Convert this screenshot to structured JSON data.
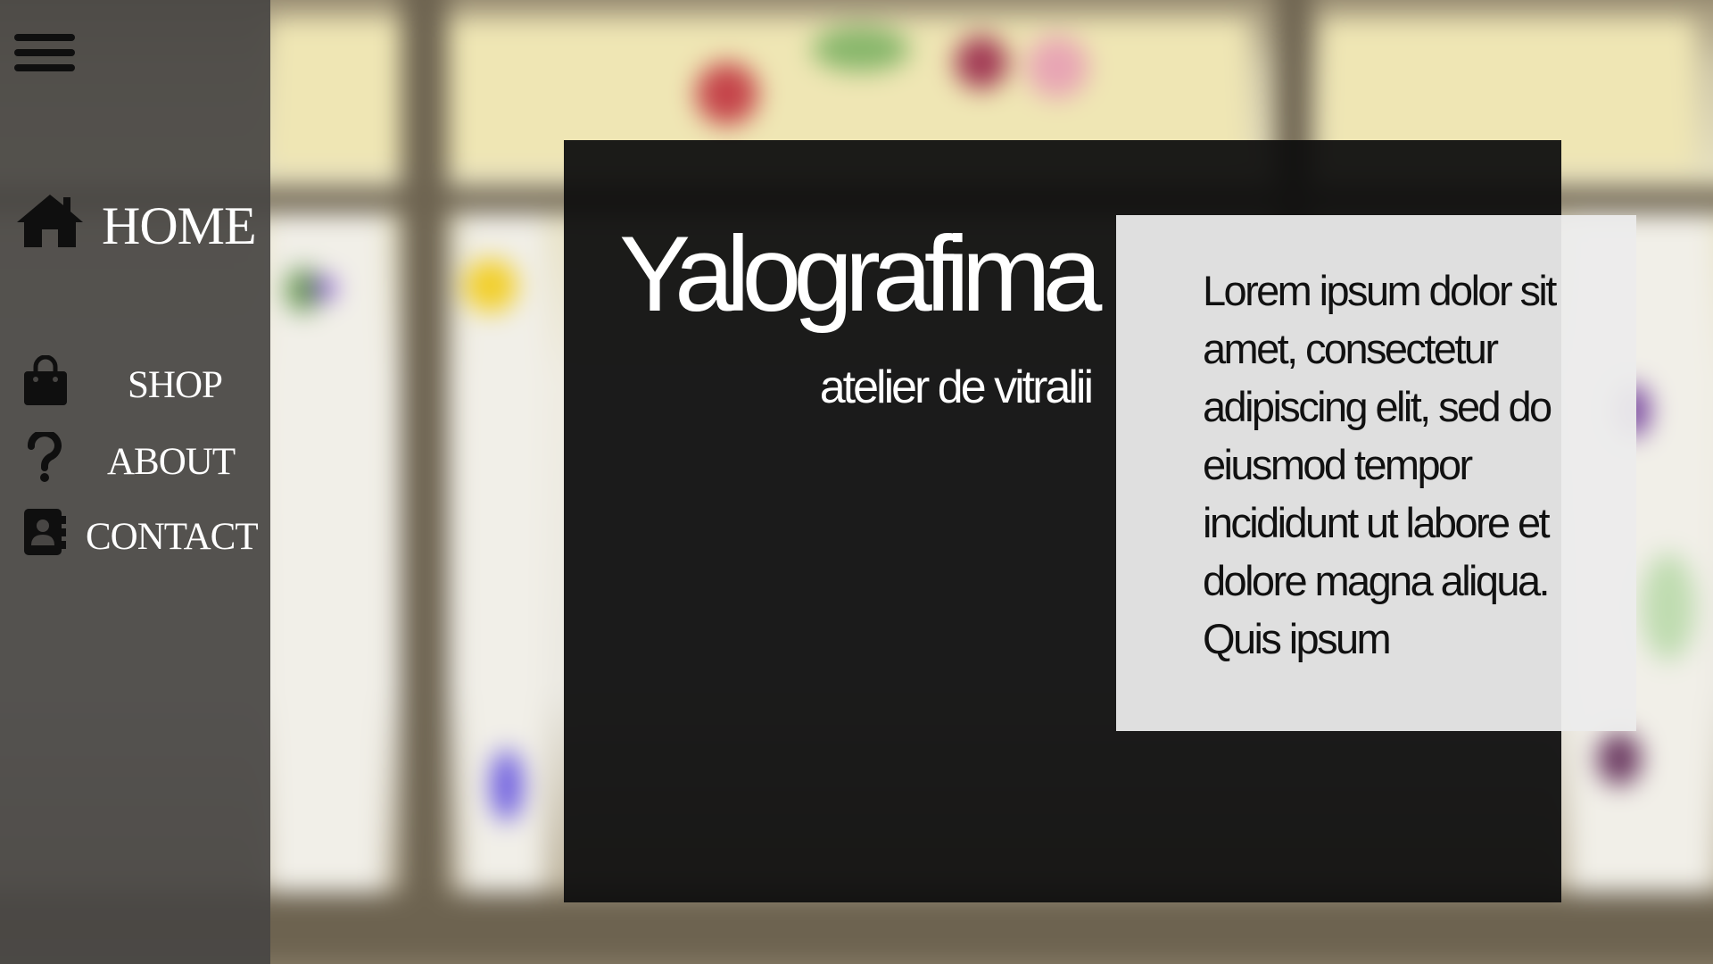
{
  "sidebar": {
    "menu_icon": "hamburger-menu-icon",
    "items": [
      {
        "label": "HOME",
        "icon": "home-icon"
      },
      {
        "label": "SHOP",
        "icon": "shopping-bag-icon"
      },
      {
        "label": "ABOUT",
        "icon": "question-mark-icon"
      },
      {
        "label": "CONTACT",
        "icon": "contact-book-icon"
      }
    ]
  },
  "hero": {
    "title": "Yalografima",
    "subtitle": "atelier de vitralii"
  },
  "intro": {
    "text": "Lorem ipsum dolor sit amet, consectetur adipiscing elit, sed do eiusmod tempor incididunt ut labore et dolore magna aliqua. Quis ipsum"
  },
  "colors": {
    "sidebar_bg": "#484644",
    "card_bg": "#0e0e0e",
    "text_box_bg": "#ececec",
    "icon_color": "#0f0f0f",
    "nav_text": "#ffffff"
  }
}
